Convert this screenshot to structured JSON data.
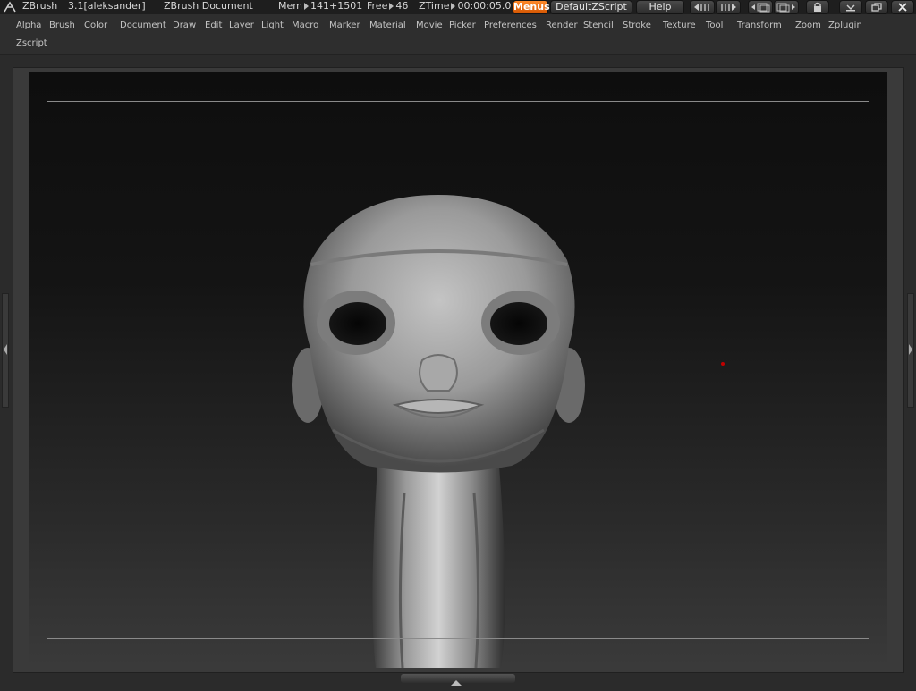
{
  "titlebar": {
    "app_name": "ZBrush",
    "version_user": "3.1[aleksander]",
    "document": "ZBrush Document",
    "mem_label": "Mem",
    "mem_value": "141+1501",
    "free_label": "Free",
    "free_value": "46",
    "ztime_label": "ZTime",
    "ztime_value": "00:00:05.0",
    "menus_label": "Menus",
    "script_label": "DefaultZScript",
    "help_label": "Help"
  },
  "menubar": {
    "items": [
      "Alpha",
      "Brush",
      "Color",
      "Document",
      "Draw",
      "Edit",
      "Layer",
      "Light",
      "Macro",
      "Marker",
      "Material",
      "Movie",
      "Picker",
      "Preferences",
      "Render",
      "Stencil",
      "Stroke",
      "Texture",
      "Tool",
      "Transform",
      "Zoom",
      "Zplugin",
      "Zscript"
    ]
  },
  "colors": {
    "accent": "#e8731a",
    "background": "#2b2b2b",
    "canvas_top": "#0e0e0e",
    "marker": "#c00000"
  },
  "icons": [
    "zbrush-logo-icon",
    "scroll-left-icon",
    "scroll-right-icon",
    "split-left-icon",
    "split-right-icon",
    "lock-icon",
    "minimize-icon",
    "restore-icon",
    "close-icon",
    "left-tray-toggle-icon",
    "right-tray-toggle-icon",
    "bottom-tray-toggle-icon"
  ]
}
